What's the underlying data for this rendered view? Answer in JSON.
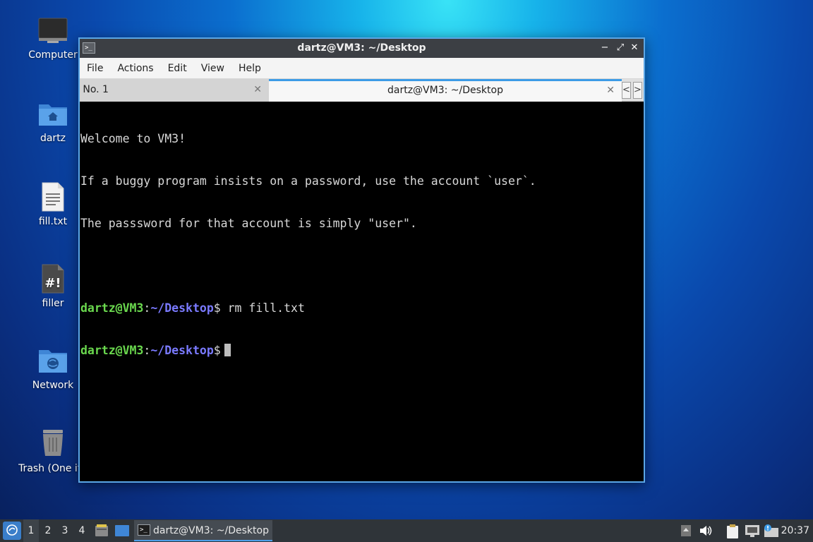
{
  "desktop": {
    "icons": [
      {
        "label": "Computer",
        "icon": "computer-icon"
      },
      {
        "label": "dartz",
        "icon": "home-folder-icon"
      },
      {
        "label": "fill.txt",
        "icon": "text-file-icon"
      },
      {
        "label": "filler",
        "icon": "script-file-icon"
      },
      {
        "label": "Network",
        "icon": "network-folder-icon"
      },
      {
        "label": "Trash (One ite",
        "icon": "trash-icon"
      }
    ]
  },
  "window": {
    "title": "dartz@VM3: ~/Desktop",
    "app_icon": ">_",
    "controls": {
      "minimize": "−",
      "maximize": "⤢",
      "close": "✕"
    }
  },
  "menu": {
    "items": [
      "File",
      "Actions",
      "Edit",
      "View",
      "Help"
    ]
  },
  "tabs": {
    "items": [
      {
        "label": "l No. 1",
        "active": false
      },
      {
        "label": "dartz@VM3: ~/Desktop",
        "active": true
      }
    ],
    "close_glyph": "✕",
    "prev": "<",
    "next": ">"
  },
  "terminal": {
    "welcome": [
      "Welcome to VM3!",
      "If a buggy program insists on a password, use the account `user`.",
      "The passsword for that account is simply \"user\"."
    ],
    "prompt": {
      "user": "dartz@VM3",
      "colon": ":",
      "path": "~/Desktop",
      "symbol": "$"
    },
    "commands": [
      {
        "text": " rm fill.txt"
      },
      {
        "text": " "
      }
    ]
  },
  "taskbar": {
    "start_glyph": "✶",
    "workspaces": [
      "1",
      "2",
      "3",
      "4"
    ],
    "current_workspace": "1",
    "task": {
      "label": "dartz@VM3: ~/Desktop",
      "icon": ">_"
    },
    "clock": "20:37",
    "tray_icons": [
      "arrow-up-icon",
      "volume-icon",
      "clipboard-icon",
      "network-icon",
      "update-notifier-icon"
    ]
  },
  "colors": {
    "prompt_user": "#6ad84e",
    "prompt_path": "#7a7aff",
    "accent": "#3c9be6",
    "window_border": "#5aa6e6"
  }
}
